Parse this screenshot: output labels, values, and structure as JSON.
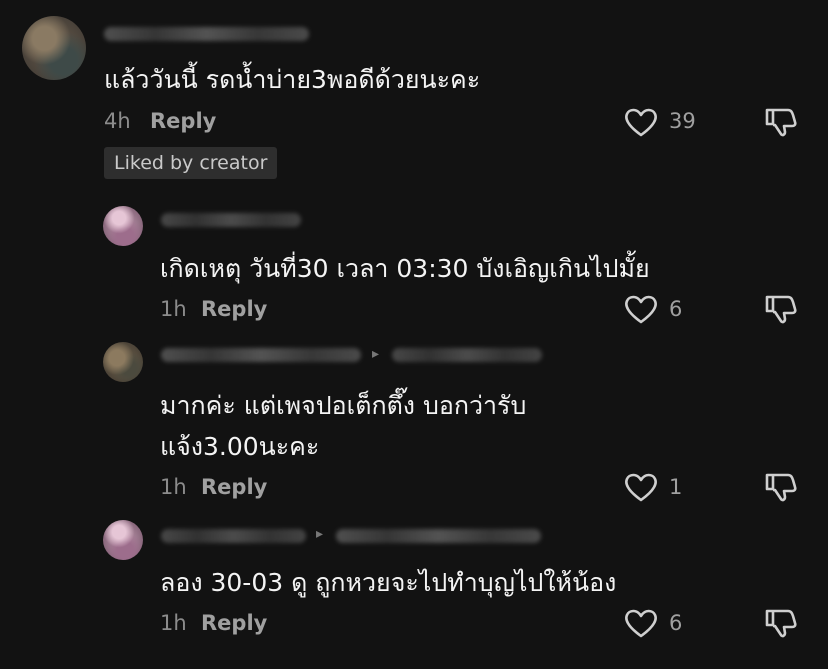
{
  "comments": [
    {
      "text": "แล้ววันนี้ รดน้ำบ่าย3พอดีด้วยนะคะ",
      "time": "4h",
      "reply_label": "Reply",
      "likes": "39",
      "badge": "Liked by creator"
    },
    {
      "text": "เกิดเหตุ วันที่30 เวลา 03:30 บังเอิญเกินไปมั้ย",
      "time": "1h",
      "reply_label": "Reply",
      "likes": "6"
    },
    {
      "text_line1": "มากค่ะ  แต่เพจปอเต็กตึ๊ง บอกว่ารับ",
      "text_line2": "แจ้ง3.00นะคะ",
      "time": "1h",
      "reply_label": "Reply",
      "likes": "1"
    },
    {
      "text": "ลอง 30-03 ดู ถูกหวยจะไปทำบุญไปให้น้อง",
      "time": "1h",
      "reply_label": "Reply",
      "likes": "6"
    }
  ],
  "icons": {
    "like": "heart-outline-icon",
    "dislike": "thumbs-down-icon"
  },
  "colors": {
    "background": "#121212",
    "text": "#f4f4f4",
    "meta": "#8c8c8c",
    "badge_bg": "#2e2e2e"
  }
}
